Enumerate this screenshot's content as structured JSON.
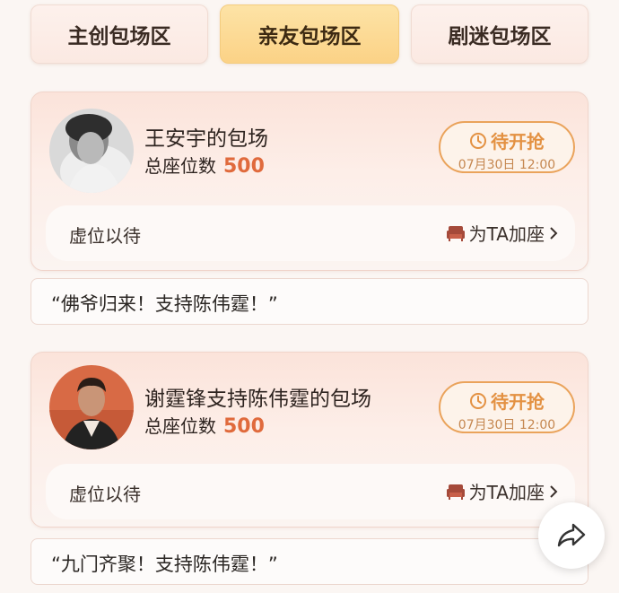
{
  "tabs": [
    {
      "label": "主创包场区",
      "active": false
    },
    {
      "label": "亲友包场区",
      "active": true
    },
    {
      "label": "剧迷包场区",
      "active": false
    }
  ],
  "cards": [
    {
      "title": "王安宇的包场",
      "seats_label": "总座位数",
      "seats_value": "500",
      "status": "待开抢",
      "status_time": "07月30日 12:00",
      "placeholder": "虚位以待",
      "add_seat": "为TA加座",
      "message": "“佛爷归来！支持陈伟霆！”"
    },
    {
      "title": "谢霆锋支持陈伟霆的包场",
      "seats_label": "总座位数",
      "seats_value": "500",
      "status": "待开抢",
      "status_time": "07月30日 12:00",
      "placeholder": "虚位以待",
      "add_seat": "为TA加座",
      "message": "“九门齐聚！支持陈伟霆！”"
    }
  ],
  "icons": {
    "clock": "clock-icon",
    "sofa": "sofa-icon",
    "chevron": "chevron-right-icon",
    "share": "share-icon"
  },
  "colors": {
    "accent": "#e06a3c",
    "status_orange": "#e39142",
    "active_tab": "#fbd286"
  }
}
